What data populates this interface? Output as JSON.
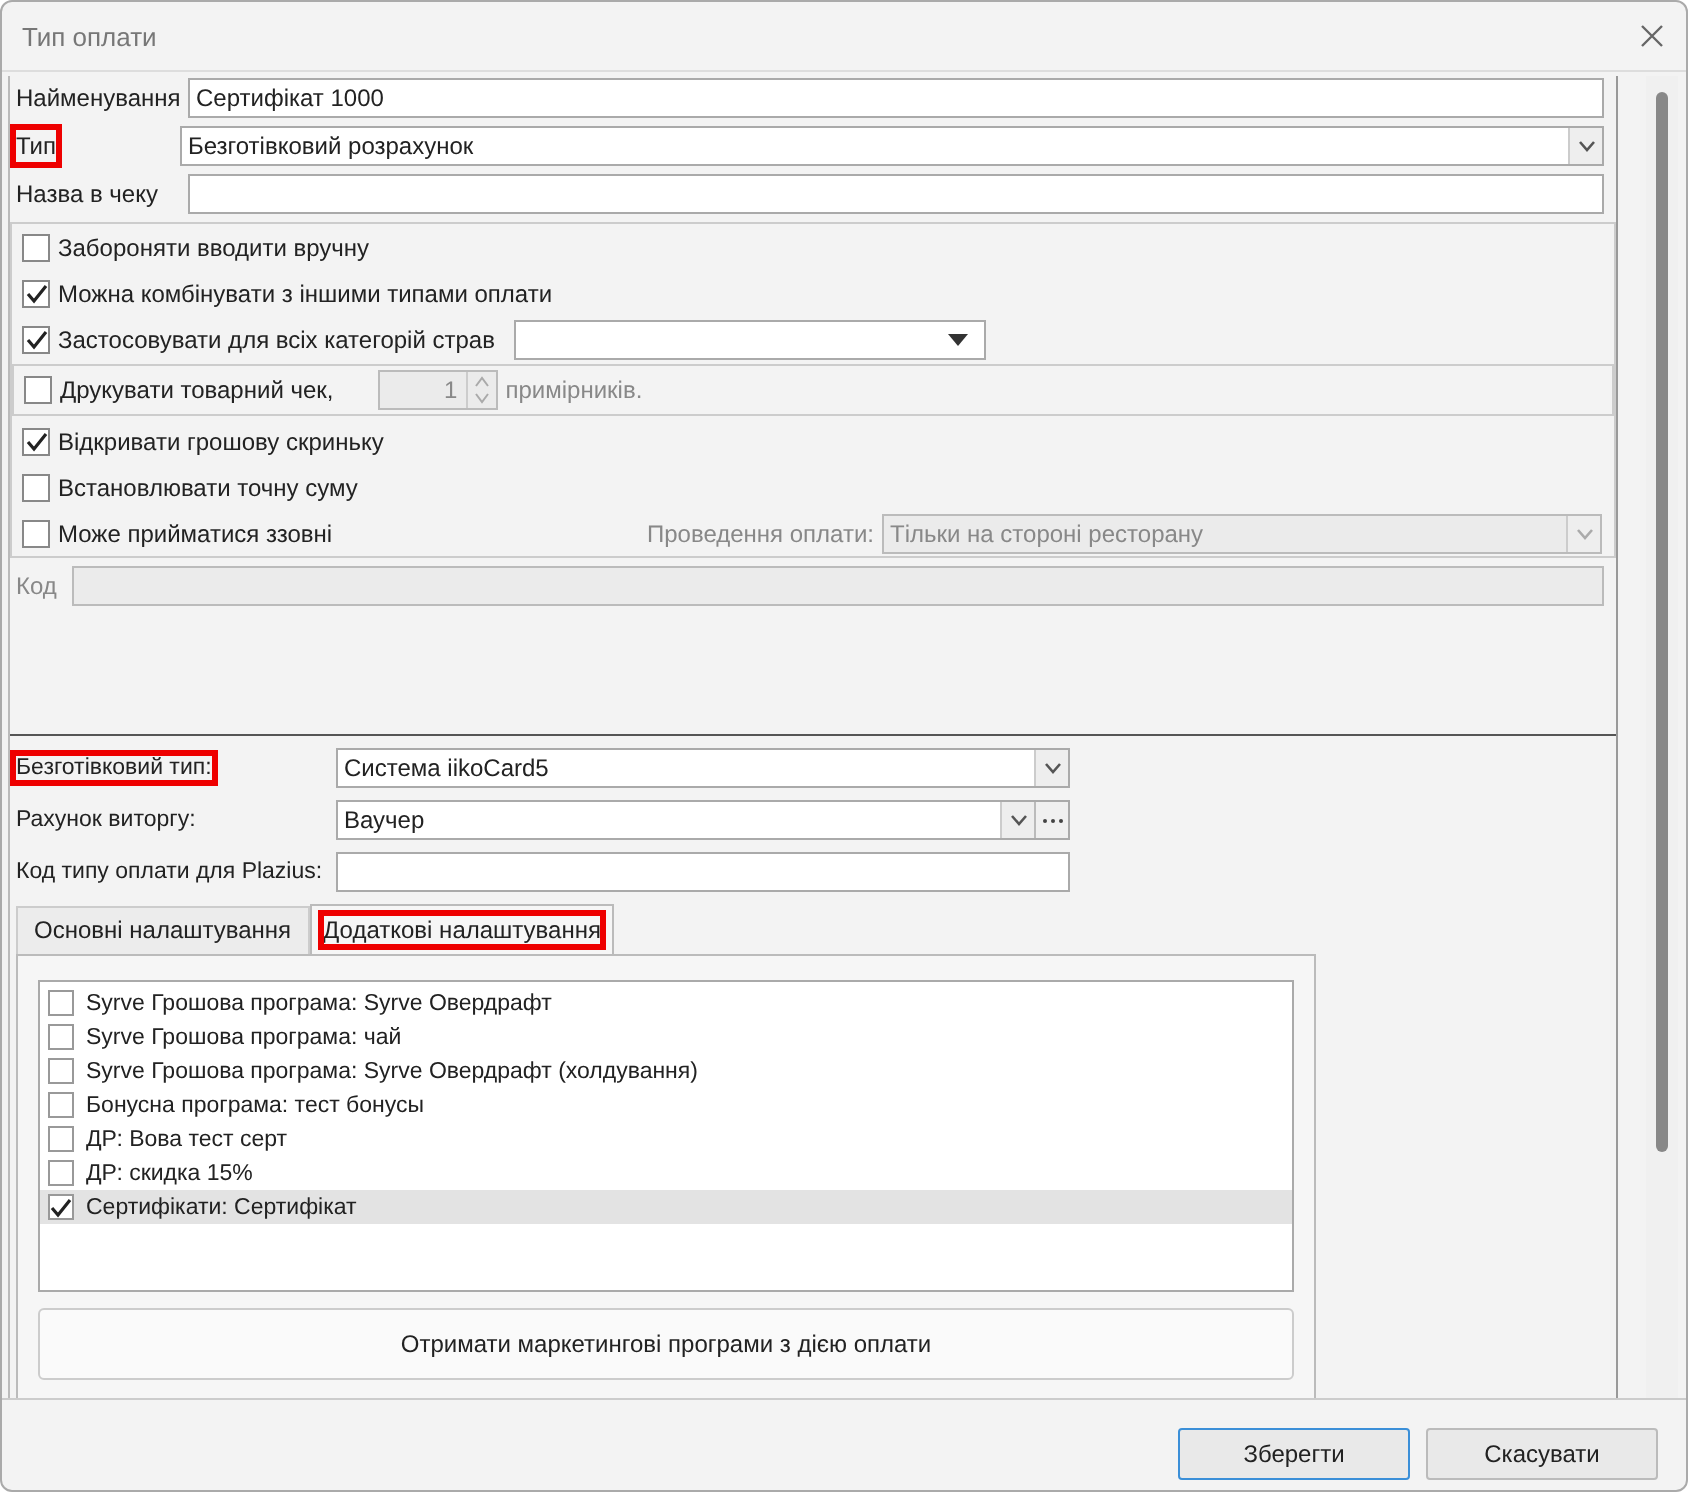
{
  "window": {
    "title": "Тип оплати"
  },
  "fields": [
    {
      "label": "Найменування",
      "kind": "text",
      "value": "Сертифікат 1000",
      "highlighted": false
    },
    {
      "label": "Тип",
      "kind": "select",
      "value": "Безготівковий розрахунок",
      "highlighted": true
    },
    {
      "label": "Назва в чеку",
      "kind": "text",
      "highlighted": false
    }
  ],
  "options": [
    {
      "kind": "plain",
      "label": "Забороняти вводити вручну",
      "checked": false
    },
    {
      "kind": "plain",
      "label": "Можна комбінувати з іншими типами оплати",
      "checked": true
    },
    {
      "kind": "combo",
      "label": "Застосовувати для всіх категорій страв",
      "checked": true
    },
    {
      "kind": "copies",
      "label": "Друкувати товарний чек,",
      "checked": false,
      "count": "1",
      "suffix": "примірників."
    },
    {
      "kind": "plain",
      "label": "Відкривати грошову скриньку",
      "checked": true
    },
    {
      "kind": "plain",
      "label": "Встановлювати точну суму",
      "checked": false
    },
    {
      "kind": "external",
      "label": "Може прийматися ззовні",
      "checked": false,
      "extra_label": "Проведення оплати:",
      "extra_value": "Тільки на стороні ресторану"
    }
  ],
  "code": {
    "label": "Код"
  },
  "noncash": {
    "fields": [
      {
        "label": "Безготівковий тип:",
        "kind": "select",
        "value": "Система iikoCard5",
        "highlighted": true
      },
      {
        "label": "Рахунок виторгу:",
        "kind": "select_more",
        "value": "Ваучер",
        "highlighted": false
      },
      {
        "label": "Код типу оплати для Plazius:",
        "kind": "text",
        "highlighted": false
      }
    ],
    "tabs": [
      {
        "label": "Основні налаштування",
        "selected": false,
        "highlighted": false
      },
      {
        "label": "Додаткові налаштування",
        "selected": true,
        "highlighted": true
      }
    ],
    "programs": [
      {
        "label": "Syrve Грошова програма: Syrve Овердрафт",
        "checked": false,
        "selected": false
      },
      {
        "label": "Syrve Грошова програма: чай",
        "checked": false,
        "selected": false
      },
      {
        "label": "Syrve Грошова програма: Syrve Овердрафт (холдування)",
        "checked": false,
        "selected": false
      },
      {
        "label": "Бонусна програма: тест бонусы",
        "checked": false,
        "selected": false
      },
      {
        "label": "ДР: Вова тест серт",
        "checked": false,
        "selected": false
      },
      {
        "label": "ДР: скидка 15%",
        "checked": false,
        "selected": false
      },
      {
        "label": "Сертифікати: Сертифікат",
        "checked": true,
        "selected": true
      }
    ],
    "fetch_button": "Отримати маркетингові програми з дією оплати"
  },
  "buttons": [
    {
      "label": "Зберегти",
      "default": true
    },
    {
      "label": "Скасувати",
      "default": false
    }
  ]
}
